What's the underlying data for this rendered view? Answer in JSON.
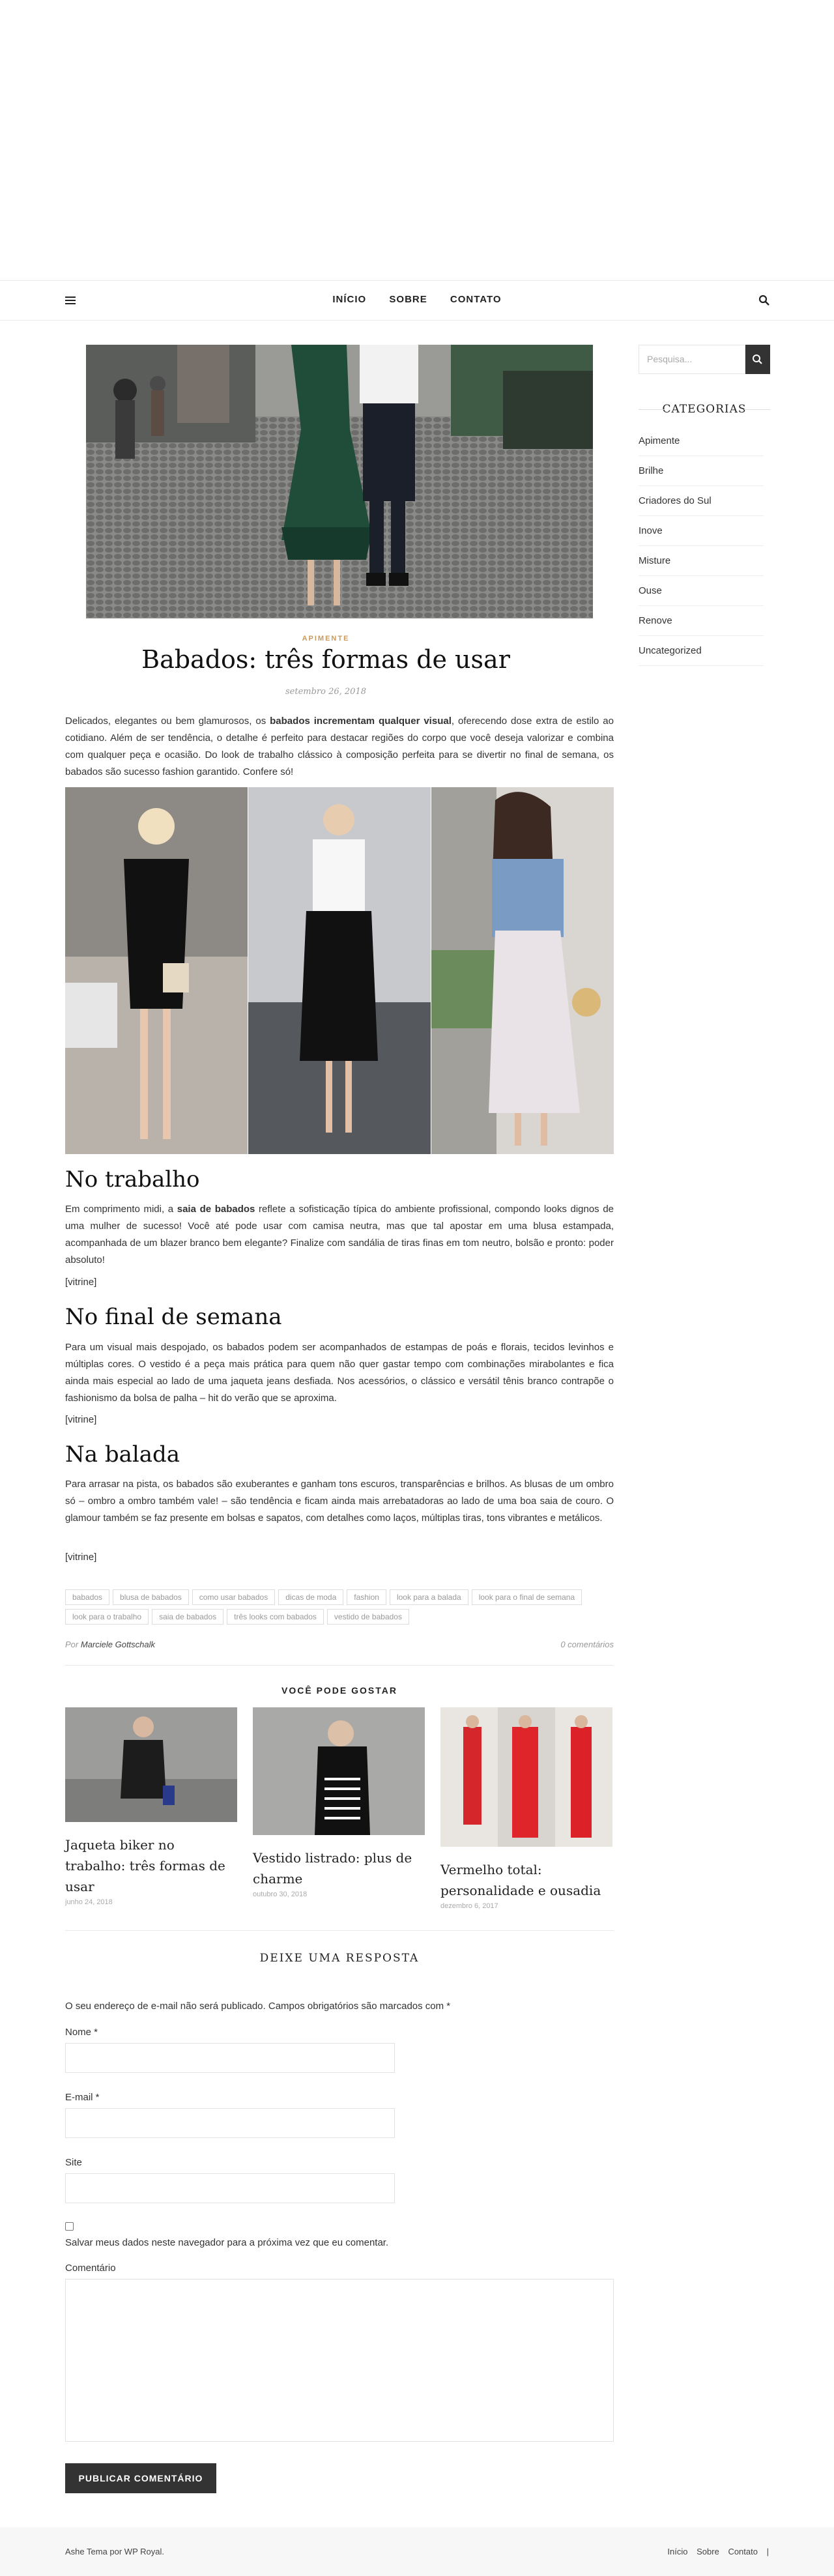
{
  "nav": {
    "menu": [
      "INÍCIO",
      "SOBRE",
      "CONTATO"
    ]
  },
  "sidebar": {
    "search_placeholder": "Pesquisa...",
    "categories_title": "CATEGORIAS",
    "categories": [
      "Apimente",
      "Brilhe",
      "Criadores do Sul",
      "Inove",
      "Misture",
      "Ouse",
      "Renove",
      "Uncategorized"
    ]
  },
  "post": {
    "category": "APIMENTE",
    "title": "Babados: três formas de usar",
    "date": "setembro 26, 2018",
    "intro_a": "Delicados, elegantes ou bem glamurosos, os ",
    "intro_b": "babados incrementam qualquer visual",
    "intro_c": ", oferecendo dose extra de estilo ao cotidiano. Além de ser tendência, o detalhe é perfeito para destacar regiões do corpo que você deseja valorizar e combina com qualquer peça e ocasião. Do look de trabalho clássico à composição perfeita para se divertir no final de semana, os babados são sucesso fashion garantido. Confere só!",
    "s1_title": "No trabalho",
    "s1_a": "Em comprimento midi, a ",
    "s1_b": "saia de babados",
    "s1_c": " reflete a sofisticação típica do ambiente profissional, compondo looks dignos de uma mulher de sucesso! Você até pode usar com camisa neutra, mas que tal apostar em uma blusa estampada, acompanhada de um blazer branco bem elegante? Finalize com sandália de tiras finas em tom neutro, bolsão e pronto: poder absoluto!",
    "s2_title": "No final de semana",
    "s2_text": "Para um visual mais despojado, os babados podem ser acompanhados de estampas de poás e florais, tecidos levinhos e múltiplas cores. O vestido é a peça mais prática para quem não quer gastar tempo com combinações mirabolantes e fica ainda mais especial ao lado de uma jaqueta jeans desfiada. Nos acessórios, o clássico e versátil tênis branco contrapõe o fashionismo da bolsa de palha – hit do verão que se aproxima.",
    "s3_title": "Na balada",
    "s3_text": "Para arrasar na pista, os babados são exuberantes e ganham tons escuros, transparências e brilhos. As blusas de um ombro só – ombro a ombro também vale! – são tendência e ficam ainda mais arrebatadoras ao lado de uma boa saia de couro. O glamour também se faz presente em bolsas e sapatos, com detalhes como laços, múltiplas tiras, tons vibrantes e metálicos.",
    "vitrine": "[vitrine]",
    "tags": [
      "babados",
      "blusa de babados",
      "como usar babados",
      "dicas de moda",
      "fashion",
      "look para a balada",
      "look para o final de semana",
      "look para o trabalho",
      "saia de babados",
      "três looks com babados",
      "vestido de babados"
    ],
    "author_prefix": "Por",
    "author": "Marciele Gottschalk",
    "comments": "0 comentários"
  },
  "related": {
    "heading": "VOCÊ PODE GOSTAR",
    "items": [
      {
        "title": "Jaqueta biker no trabalho: três formas de usar",
        "date": "junho 24, 2018"
      },
      {
        "title": "Vestido listrado: plus de charme",
        "date": "outubro 30, 2018"
      },
      {
        "title": "Vermelho total: personalidade e ousadia",
        "date": "dezembro 6, 2017"
      }
    ]
  },
  "reply": {
    "heading": "DEIXE UMA RESPOSTA",
    "notice": "O seu endereço de e-mail não será publicado. Campos obrigatórios são marcados com *",
    "name_label": "Nome *",
    "email_label": "E-mail *",
    "site_label": "Site",
    "save_label": "Salvar meus dados neste navegador para a próxima vez que eu comentar.",
    "comment_label": "Comentário",
    "submit": "PUBLICAR COMENTÁRIO"
  },
  "footer": {
    "credit": "Ashe Tema por WP Royal.",
    "links": [
      "Início",
      "Sobre",
      "Contato"
    ]
  },
  "colors": {
    "accent": "#c99a5b",
    "dark": "#333333"
  }
}
